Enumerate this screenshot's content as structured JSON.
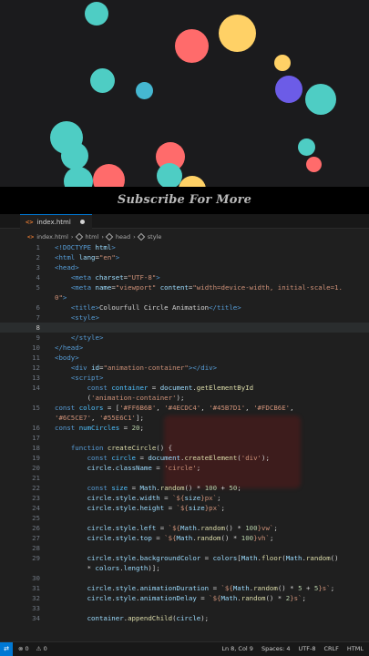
{
  "preview": {
    "banner_text": "Subscribe For More",
    "circles": [
      {
        "color": "#4ECDC4"
      },
      {
        "color": "#FFD166"
      },
      {
        "color": "#FF6B6B"
      },
      {
        "color": "#FFD166"
      },
      {
        "color": "#6C5CE7"
      },
      {
        "color": "#4ECDC4"
      },
      {
        "color": "#45B7D1"
      },
      {
        "color": "#4ECDC4"
      },
      {
        "color": "#4ECDC4"
      },
      {
        "color": "#FF6B6B"
      },
      {
        "color": "#4ECDC4"
      },
      {
        "color": "#4ECDC4"
      },
      {
        "color": "#FF6B6B"
      },
      {
        "color": "#4ECDC4"
      },
      {
        "color": "#FF6B6B"
      },
      {
        "color": "#FFD166"
      },
      {
        "color": "#4ECDC4"
      }
    ]
  },
  "editor": {
    "tab_icon": "<>",
    "tab_name": "index.html",
    "breadcrumb": {
      "file": "index.html",
      "items": [
        "html",
        "head",
        "style"
      ]
    },
    "lines": [
      {
        "n": "1",
        "html": "<span class=\"tag\">&lt;!DOCTYPE</span> <span class=\"attr\">html</span><span class=\"tag\">&gt;</span>"
      },
      {
        "n": "2",
        "html": "<span class=\"tag\">&lt;html</span> <span class=\"attr\">lang</span>=<span class=\"str\">\"en\"</span><span class=\"tag\">&gt;</span>"
      },
      {
        "n": "3",
        "html": "<span class=\"tag\">&lt;head&gt;</span>"
      },
      {
        "n": "4",
        "html": "    <span class=\"tag\">&lt;meta</span> <span class=\"attr\">charset</span>=<span class=\"str\">\"UTF-8\"</span><span class=\"tag\">&gt;</span>"
      },
      {
        "n": "5",
        "html": "    <span class=\"tag\">&lt;meta</span> <span class=\"attr\">name</span>=<span class=\"str\">\"viewport\"</span> <span class=\"attr\">content</span>=<span class=\"str\">\"width=device-width, initial-scale=1.</span>",
        "wrap": "<span class=\"str\">0\"</span><span class=\"tag\">&gt;</span>"
      },
      {
        "n": "6",
        "html": "    <span class=\"tag\">&lt;title&gt;</span>Colourfull Circle Animation<span class=\"tag\">&lt;/title&gt;</span>"
      },
      {
        "n": "7",
        "html": "    <span class=\"tag\">&lt;style&gt;</span>"
      },
      {
        "n": "8",
        "html": "",
        "hl": true
      },
      {
        "n": "9",
        "html": "    <span class=\"tag\">&lt;/style&gt;</span>"
      },
      {
        "n": "10",
        "html": "<span class=\"tag\">&lt;/head&gt;</span>"
      },
      {
        "n": "11",
        "html": "<span class=\"tag\">&lt;body&gt;</span>"
      },
      {
        "n": "12",
        "html": "    <span class=\"tag\">&lt;div</span> <span class=\"attr\">id</span>=<span class=\"str\">\"animation-container\"</span><span class=\"tag\">&gt;&lt;/div&gt;</span>"
      },
      {
        "n": "13",
        "html": "    <span class=\"tag\">&lt;script&gt;</span>"
      },
      {
        "n": "14",
        "html": "        <span class=\"kw\">const</span> <span class=\"var\">container</span> = <span class=\"attr\">document</span>.<span class=\"fn\">getElementById</span>",
        "wrap": "        (<span class=\"str\">'animation-container'</span>);"
      },
      {
        "n": "15",
        "html": "<span class=\"kw\">const</span> <span class=\"var\">colors</span> = [<span class=\"str\">'#FF6B6B'</span>, <span class=\"str\">'#4ECDC4'</span>, <span class=\"str\">'#45B7D1'</span>, <span class=\"str\">'#FDCB6E'</span>,",
        "wrap": "<span class=\"str\">'#6C5CE7'</span>, <span class=\"str\">'#55E6C1'</span>];"
      },
      {
        "n": "16",
        "html": "<span class=\"kw\">const</span> <span class=\"var\">numCircles</span> = <span class=\"num\">20</span>;"
      },
      {
        "n": "17",
        "html": ""
      },
      {
        "n": "18",
        "html": "    <span class=\"kw\">function</span> <span class=\"fn\">createCircle</span>() {"
      },
      {
        "n": "19",
        "html": "        <span class=\"kw\">const</span> <span class=\"var\">circle</span> = <span class=\"attr\">document</span>.<span class=\"fn\">createElement</span>(<span class=\"str\">'div'</span>);"
      },
      {
        "n": "20",
        "html": "        <span class=\"attr\">circle</span>.<span class=\"attr\">className</span> = <span class=\"str\">'circle'</span>;"
      },
      {
        "n": "21",
        "html": ""
      },
      {
        "n": "22",
        "html": "        <span class=\"kw\">const</span> <span class=\"var\">size</span> = <span class=\"attr\">Math</span>.<span class=\"fn\">random</span>() * <span class=\"num\">100</span> + <span class=\"num\">50</span>;"
      },
      {
        "n": "23",
        "html": "        <span class=\"attr\">circle</span>.<span class=\"attr\">style</span>.<span class=\"attr\">width</span> = <span class=\"str\">`${</span><span class=\"attr\">size</span><span class=\"str\">}px`</span>;"
      },
      {
        "n": "24",
        "html": "        <span class=\"attr\">circle</span>.<span class=\"attr\">style</span>.<span class=\"attr\">height</span> = <span class=\"str\">`${</span><span class=\"attr\">size</span><span class=\"str\">}px`</span>;"
      },
      {
        "n": "25",
        "html": ""
      },
      {
        "n": "26",
        "html": "        <span class=\"attr\">circle</span>.<span class=\"attr\">style</span>.<span class=\"attr\">left</span> = <span class=\"str\">`${</span><span class=\"attr\">Math</span>.<span class=\"fn\">random</span>() * <span class=\"num\">100</span><span class=\"str\">}vw`</span>;"
      },
      {
        "n": "27",
        "html": "        <span class=\"attr\">circle</span>.<span class=\"attr\">style</span>.<span class=\"attr\">top</span> = <span class=\"str\">`${</span><span class=\"attr\">Math</span>.<span class=\"fn\">random</span>() * <span class=\"num\">100</span><span class=\"str\">}vh`</span>;"
      },
      {
        "n": "28",
        "html": ""
      },
      {
        "n": "29",
        "html": "        <span class=\"attr\">circle</span>.<span class=\"attr\">style</span>.<span class=\"attr\">backgroundColor</span> = <span class=\"attr\">colors</span>[<span class=\"attr\">Math</span>.<span class=\"fn\">floor</span>(<span class=\"attr\">Math</span>.<span class=\"fn\">random</span>()",
        "wrap": "        * <span class=\"attr\">colors</span>.<span class=\"attr\">length</span>)];"
      },
      {
        "n": "30",
        "html": ""
      },
      {
        "n": "31",
        "html": "        <span class=\"attr\">circle</span>.<span class=\"attr\">style</span>.<span class=\"attr\">animationDuration</span> = <span class=\"str\">`${</span><span class=\"attr\">Math</span>.<span class=\"fn\">random</span>() * <span class=\"num\">5</span> + <span class=\"num\">5</span><span class=\"str\">}s`</span>;"
      },
      {
        "n": "32",
        "html": "        <span class=\"attr\">circle</span>.<span class=\"attr\">style</span>.<span class=\"attr\">animationDelay</span> = <span class=\"str\">`${</span><span class=\"attr\">Math</span>.<span class=\"fn\">random</span>() * <span class=\"num\">2</span><span class=\"str\">}s`</span>;"
      },
      {
        "n": "33",
        "html": ""
      },
      {
        "n": "34",
        "html": "        <span class=\"attr\">container</span>.<span class=\"fn\">appendChild</span>(<span class=\"attr\">circle</span>);"
      }
    ]
  },
  "statusbar": {
    "errors": "0",
    "warnings": "0",
    "cursor": "Ln 8, Col 9",
    "spaces": "Spaces: 4",
    "encoding": "UTF-8",
    "eol": "CRLF",
    "language": "HTML"
  }
}
